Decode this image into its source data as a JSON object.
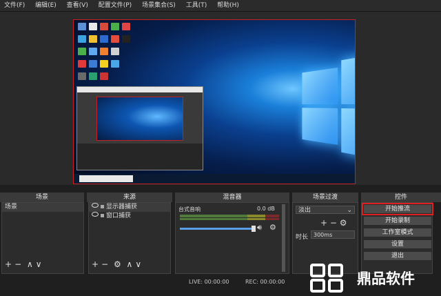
{
  "menu": [
    "文件(F)",
    "编辑(E)",
    "查看(V)",
    "配置文件(P)",
    "场景集合(S)",
    "工具(T)",
    "帮助(H)"
  ],
  "docks": {
    "scenes_title": "场景",
    "sources_title": "来源",
    "mixer_title": "混音器",
    "transitions_title": "场景过渡",
    "controls_title": "控件"
  },
  "scenes": [
    "场景"
  ],
  "sources": [
    "显示器捕获",
    "窗口捕获"
  ],
  "mixer": {
    "channel": "台式音响",
    "db": "0.0 dB"
  },
  "transition": {
    "type": "淡出",
    "duration_label": "时长",
    "duration": "300ms"
  },
  "controls": [
    "开始推流",
    "开始录制",
    "工作室模式",
    "设置",
    "退出"
  ],
  "status": {
    "live": "LIVE: 00:00:00",
    "rec": "REC: 00:00:00"
  },
  "watermark": {
    "brand": "鼎品软件"
  },
  "colors": {
    "highlight": "#e02020",
    "preview_border": "#c82020"
  }
}
